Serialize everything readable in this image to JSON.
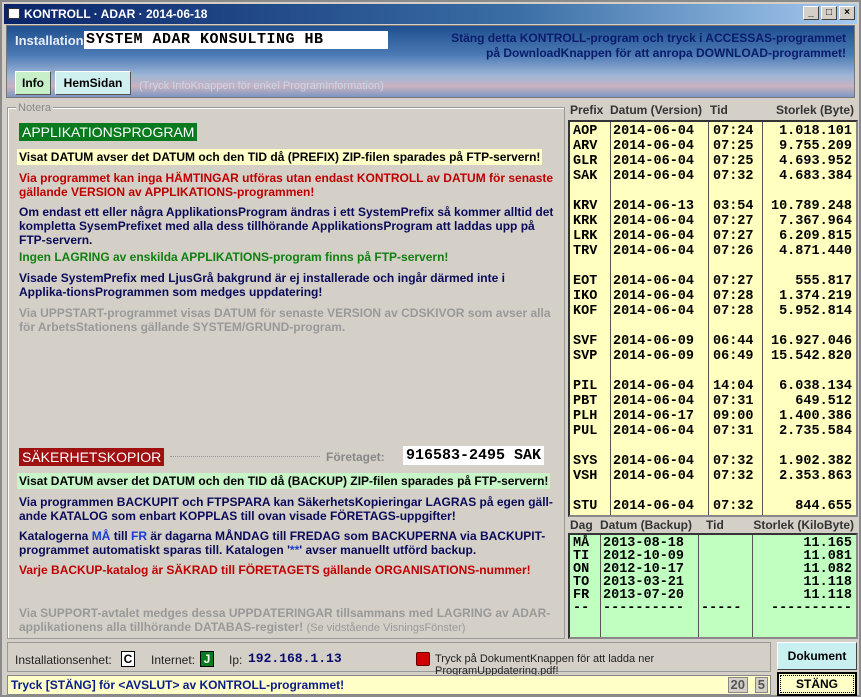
{
  "window": {
    "title": "KONTROLL · ADAR · 2014-06-18",
    "min": "_",
    "max": "□",
    "close": "×"
  },
  "header": {
    "installation_label": "Installation:",
    "installation_value": "SYSTEM ADAR KONSULTING HB",
    "note_line1": "Stäng detta KONTROLL-program och tryck i ACCESSAS-programmet",
    "note_line2": "på DownloadKnappen för att anropa DOWNLOAD-programmet!",
    "info_button": "Info",
    "home_button": "HemSidan",
    "hint": "(Tryck InfoKnappen för enkel ProgramInformation)"
  },
  "notes": {
    "legend": "Notera",
    "app_title": "APPLIKATIONSPROGRAM",
    "app_p1": "Visat DATUM avser det DATUM och den TID då (PREFIX) ZIP-filen sparades på FTP-servern!",
    "app_p2": "Via programmet kan inga HÄMTINGAR utföras utan endast KONTROLL av DATUM för senaste gällande VERSION av APPLIKATIONS-programmen!",
    "app_p3": "Om endast ett eller några ApplikationsProgram ändras i ett SystemPrefix så kommer alltid det kompletta SysemPrefixet med alla dess tillhörande ApplikationsProgram att laddas upp på FTP-servern.",
    "app_p4": "Ingen LAGRING av enskilda APPLIKATIONS-program finns på FTP-servern!",
    "app_p5": "Visade SystemPrefix med LjusGrå bakgrund är ej installerade och ingår därmed inte i Applika-tionsProgrammen som medges uppdatering!",
    "app_p6": "Via UPPSTART-programmet visas DATUM för senaste VERSION av CDSKIVOR som avser alla för ArbetsStationens gällande SYSTEM/GRUND-program.",
    "backup_title": "SÄKERHETSKOPIOR",
    "company_label": "Företaget:",
    "company_value": "916583-2495 SAK",
    "bk_p1": "Visat DATUM avser det DATUM och den TID då (BACKUP) ZIP-filen sparades på FTP-servern!",
    "bk_p2": "Via programmen BACKUPIT och FTPSPARA kan SäkerhetsKopieringar LAGRAS på egen gäll-ande KATALOG som enbart KOPPLAS till ovan visade FÖRETAGS-uppgifter!",
    "bk_p3a": "Katalogerna ",
    "bk_p3b": "MÅ",
    "bk_p3c": " till ",
    "bk_p3d": "FR",
    "bk_p3e": " är dagarna MÅNDAG till FREDAG som BACKUPERNA via BACKUPIT-programmet automatiskt sparas till. Katalogen '",
    "bk_p3f": "**",
    "bk_p3g": "' avser manuellt utförd backup.",
    "bk_p4": "Varje BACKUP-katalog är SÄKRAD till FÖRETAGETS gällande ORGANISATIONS-nummer!",
    "bk_p5": "Via SUPPORT-avtalet medges dessa UPPDATERINGAR tillsammans med LAGRING av ADAR-applikationens alla tillhörande DATABAS-register!",
    "bk_p5_hint": "(Se vidstående VisningsFönster)"
  },
  "versions": {
    "headers": [
      "Prefix",
      "Datum (Version)",
      "Tid",
      "Storlek (Byte)"
    ],
    "groups": [
      [
        [
          "AOP",
          "2014-06-04",
          "07:24",
          "1.018.101"
        ],
        [
          "ARV",
          "2014-06-04",
          "07:25",
          "9.755.209"
        ],
        [
          "GLR",
          "2014-06-04",
          "07:25",
          "4.693.952"
        ],
        [
          "SAK",
          "2014-06-04",
          "07:32",
          "4.683.384"
        ]
      ],
      [
        [
          "KRV",
          "2014-06-13",
          "03:54",
          "10.789.248"
        ],
        [
          "KRK",
          "2014-06-04",
          "07:27",
          "7.367.964"
        ],
        [
          "LRK",
          "2014-06-04",
          "07:27",
          "6.209.815"
        ],
        [
          "TRV",
          "2014-06-04",
          "07:26",
          "4.871.440"
        ]
      ],
      [
        [
          "EOT",
          "2014-06-04",
          "07:27",
          "555.817"
        ],
        [
          "IKO",
          "2014-06-04",
          "07:28",
          "1.374.219"
        ],
        [
          "KOF",
          "2014-06-04",
          "07:28",
          "5.952.814"
        ]
      ],
      [
        [
          "SVF",
          "2014-06-09",
          "06:44",
          "16.927.046"
        ],
        [
          "SVP",
          "2014-06-09",
          "06:49",
          "15.542.820"
        ]
      ],
      [
        [
          "PIL",
          "2014-06-04",
          "14:04",
          "6.038.134"
        ],
        [
          "PBT",
          "2014-06-04",
          "07:31",
          "649.512"
        ],
        [
          "PLH",
          "2014-06-17",
          "09:00",
          "1.400.386"
        ],
        [
          "PUL",
          "2014-06-04",
          "07:31",
          "2.735.584"
        ]
      ],
      [
        [
          "SYS",
          "2014-06-04",
          "07:32",
          "1.902.382"
        ],
        [
          "VSH",
          "2014-06-04",
          "07:32",
          "2.353.863"
        ]
      ],
      [
        [
          "STU",
          "2014-06-04",
          "07:32",
          "844.655"
        ]
      ]
    ]
  },
  "backups": {
    "headers": [
      "Dag",
      "Datum (Backup)",
      "Tid",
      "Storlek (KiloByte)"
    ],
    "rows": [
      [
        "MÅ",
        "2013-08-18",
        "",
        "11.165"
      ],
      [
        "TI",
        "2012-10-09",
        "",
        "11.081"
      ],
      [
        "ON",
        "2012-10-17",
        "",
        "11.082"
      ],
      [
        "TO",
        "2013-03-21",
        "",
        "11.118"
      ],
      [
        "FR",
        "2013-07-20",
        "",
        "11.118"
      ],
      [
        "--",
        "----------",
        "-----",
        "----------"
      ]
    ]
  },
  "status": {
    "unit_label": "Installationsenhet:",
    "unit_value": "C",
    "internet_label": "Internet:",
    "internet_value": "J",
    "ip_label": "Ip:",
    "ip_value": "192.168.1.13",
    "doc_hint": "Tryck på DokumentKnappen för att ladda ner ProgramUppdatering.pdf!",
    "document_button": "Dokument",
    "message": "Tryck [STÄNG] för <AVSLUT> av KONTROLL-programmet!",
    "count1": "20",
    "count2": "5",
    "close_button": "STÄNG"
  },
  "colors": {
    "app_title_bg": "#0a7a1e",
    "backup_title_bg": "#a01010",
    "version_list_bg": "#ffffc0",
    "backup_list_bg": "#c0ffc0",
    "red_text": "#c00000",
    "green_text": "#108010",
    "navy_text": "#0a0a5a"
  }
}
